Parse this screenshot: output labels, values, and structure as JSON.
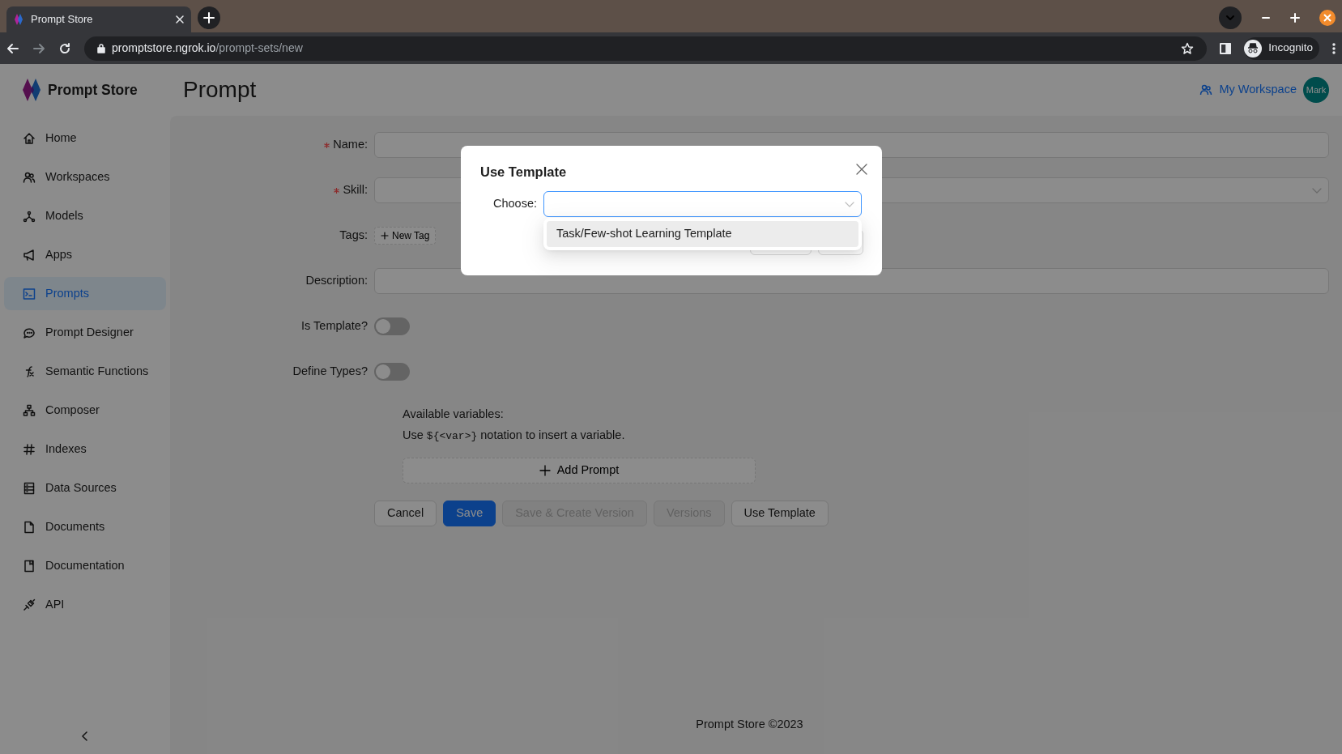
{
  "browser": {
    "tab_title": "Prompt Store",
    "url_host": "promptstore.ngrok.io",
    "url_path": "/prompt-sets/new",
    "profile_label": "Incognito"
  },
  "sidebar": {
    "brand": "Prompt Store",
    "items": [
      {
        "label": "Home",
        "selected": false
      },
      {
        "label": "Workspaces",
        "selected": false
      },
      {
        "label": "Models",
        "selected": false
      },
      {
        "label": "Apps",
        "selected": false
      },
      {
        "label": "Prompts",
        "selected": true
      },
      {
        "label": "Prompt Designer",
        "selected": false
      },
      {
        "label": "Semantic Functions",
        "selected": false
      },
      {
        "label": "Composer",
        "selected": false
      },
      {
        "label": "Indexes",
        "selected": false
      },
      {
        "label": "Data Sources",
        "selected": false
      },
      {
        "label": "Documents",
        "selected": false
      },
      {
        "label": "Documentation",
        "selected": false
      },
      {
        "label": "API",
        "selected": false
      }
    ]
  },
  "header": {
    "title": "Prompt",
    "workspace_link": "My Workspace",
    "avatar": "Mark"
  },
  "form": {
    "fields": [
      {
        "kind": "input",
        "label": "Name:",
        "required": true
      },
      {
        "kind": "select",
        "label": "Skill:",
        "required": true
      },
      {
        "kind": "tags",
        "label": "Tags:",
        "required": false,
        "button": "New Tag"
      },
      {
        "kind": "input",
        "label": "Description:",
        "required": false
      },
      {
        "kind": "switch",
        "label": "Is Template?",
        "required": false,
        "on": false
      },
      {
        "kind": "switch",
        "label": "Define Types?",
        "required": false,
        "on": false
      }
    ],
    "help_title": "Available variables:",
    "help": {
      "before": "Use ",
      "code": "${<var>}",
      "after": " notation to insert a variable."
    },
    "add_prompt": "Add Prompt",
    "buttons": [
      {
        "label": "Cancel",
        "kind": "default",
        "disabled": false
      },
      {
        "label": "Save",
        "kind": "primary",
        "disabled": false
      },
      {
        "label": "Save & Create Version",
        "kind": "default",
        "disabled": true
      },
      {
        "label": "Versions",
        "kind": "default",
        "disabled": true
      },
      {
        "label": "Use Template",
        "kind": "default",
        "disabled": false
      }
    ]
  },
  "footer": "Prompt Store ©2023",
  "modal": {
    "title": "Use Template",
    "field_label": "Choose:",
    "options": [
      {
        "label": "Task/Few-shot Learning Template",
        "highlighted": true
      }
    ]
  }
}
